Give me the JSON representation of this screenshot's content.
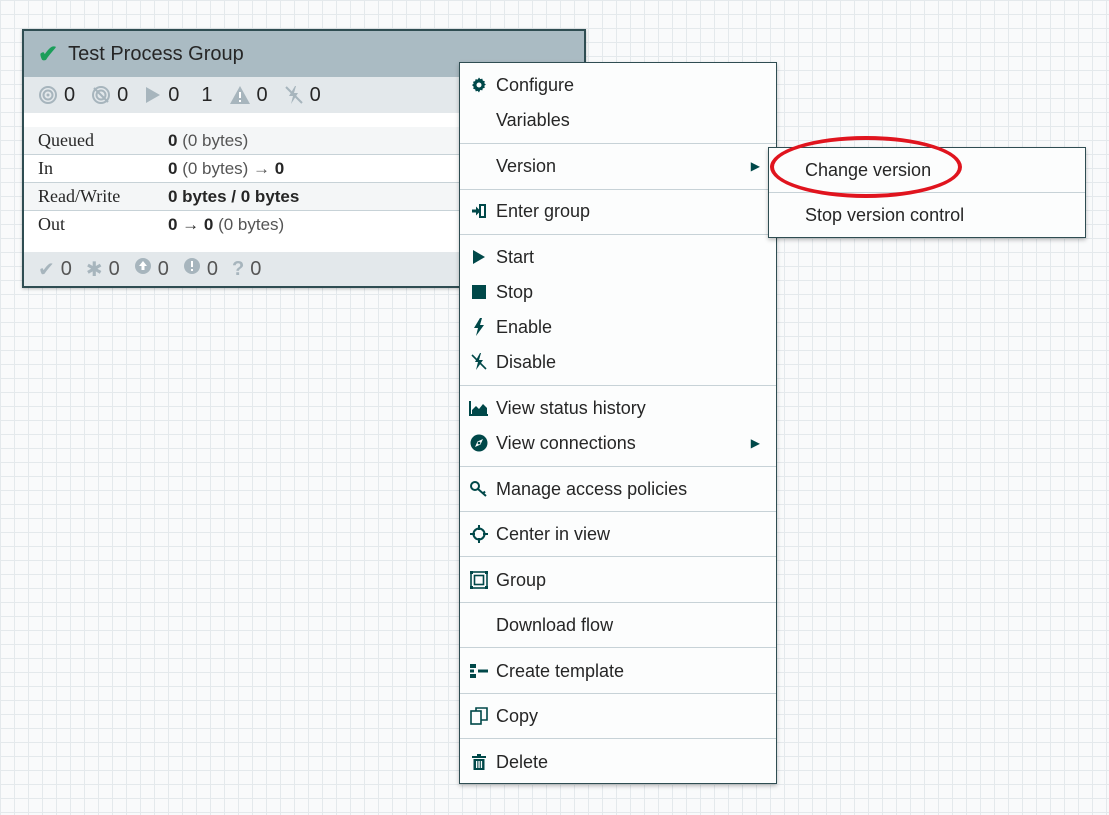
{
  "process_group": {
    "title": "Test Process Group",
    "status_icon": "checkmark-icon",
    "stats": [
      {
        "icon": "transmitting-icon",
        "value": "0"
      },
      {
        "icon": "not-transmitting-icon",
        "value": "0"
      },
      {
        "icon": "running-icon",
        "value": "0"
      },
      {
        "icon": "stopped-icon",
        "value": "1"
      },
      {
        "icon": "invalid-icon",
        "value": "0"
      },
      {
        "icon": "disabled-icon",
        "value": "0"
      }
    ],
    "rows": [
      {
        "label": "Queued",
        "value_bold": "0",
        "value_rest": " (0 bytes)"
      },
      {
        "label": "In",
        "value_bold": "0",
        "value_rest": " (0 bytes) → ",
        "value_tail": "0"
      },
      {
        "label": "Read/Write",
        "value_bold": "0 bytes / 0 bytes",
        "value_rest": ""
      },
      {
        "label": "Out",
        "value_bold": "0 → 0",
        "value_rest": " (0 bytes)"
      }
    ],
    "footer": [
      {
        "icon": "up-to-date-icon",
        "value": "0"
      },
      {
        "icon": "locally-modified-icon",
        "value": "0"
      },
      {
        "icon": "stale-icon",
        "value": "0"
      },
      {
        "icon": "locally-modified-and-stale-icon",
        "value": "0"
      },
      {
        "icon": "sync-failure-icon",
        "value": "0"
      }
    ]
  },
  "context_menu": {
    "items": [
      {
        "label": "Configure",
        "icon": "gear-icon"
      },
      {
        "label": "Variables",
        "icon": ""
      },
      {
        "label": "Version",
        "icon": "",
        "submenu": true
      },
      {
        "label": "Enter group",
        "icon": "enter-icon"
      },
      {
        "label": "Start",
        "icon": "play-icon"
      },
      {
        "label": "Stop",
        "icon": "stop-icon"
      },
      {
        "label": "Enable",
        "icon": "lightning-icon"
      },
      {
        "label": "Disable",
        "icon": "disabled-lightning-icon"
      },
      {
        "label": "View status history",
        "icon": "area-chart-icon"
      },
      {
        "label": "View connections",
        "icon": "compass-icon",
        "submenu": true
      },
      {
        "label": "Manage access policies",
        "icon": "key-icon"
      },
      {
        "label": "Center in view",
        "icon": "crosshairs-icon"
      },
      {
        "label": "Group",
        "icon": "group-icon"
      },
      {
        "label": "Download flow",
        "icon": ""
      },
      {
        "label": "Create template",
        "icon": "template-icon"
      },
      {
        "label": "Copy",
        "icon": "copy-icon"
      },
      {
        "label": "Delete",
        "icon": "trash-icon"
      }
    ]
  },
  "version_submenu": {
    "items": [
      {
        "label": "Change version"
      },
      {
        "label": "Stop version control"
      }
    ]
  },
  "colors": {
    "menu_icon": "#004849",
    "border": "#2f4d52",
    "highlight": "#e0141e",
    "header_bg": "#aabbc3",
    "stopped": "#c7686b",
    "ok_check": "#1b9e5a"
  }
}
